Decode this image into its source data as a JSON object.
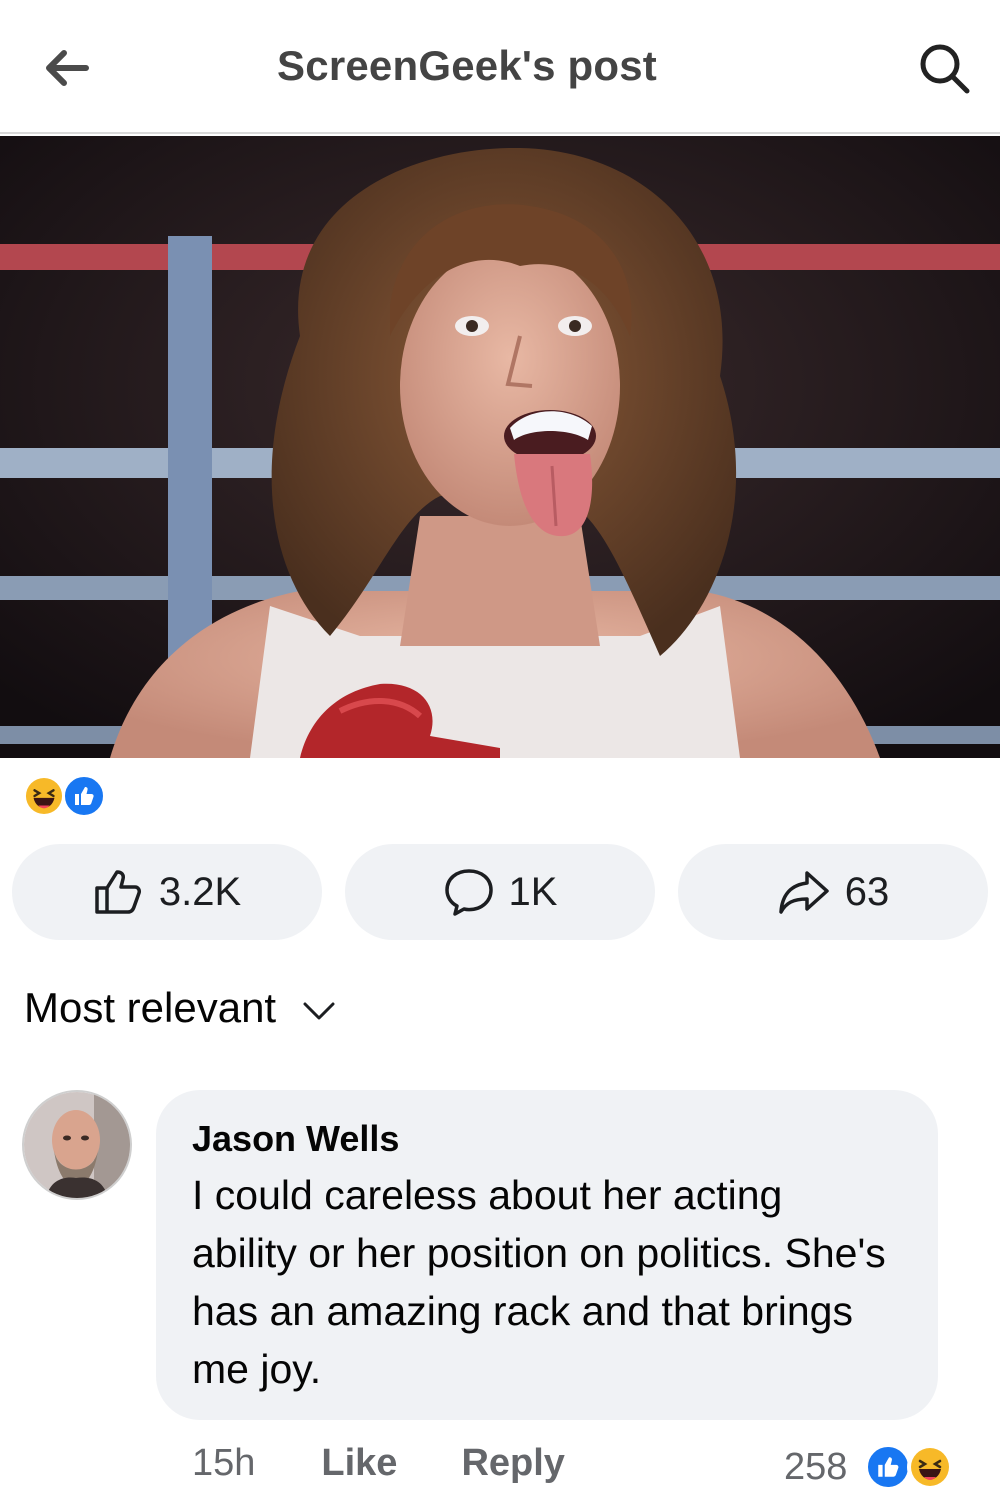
{
  "header": {
    "title": "ScreenGeek's post"
  },
  "post": {
    "reactions": {
      "icons": [
        "haha-icon",
        "like-icon"
      ]
    },
    "actions": {
      "like_count": "3.2K",
      "comment_count": "1K",
      "share_count": "63"
    }
  },
  "comments": {
    "sort_label": "Most relevant",
    "items": [
      {
        "author": "Jason Wells",
        "text": "I could careless about her acting ability or her position on politics. She's has an amazing rack and that brings me joy.",
        "time": "15h",
        "like_label": "Like",
        "reply_label": "Reply",
        "reaction_count": "258",
        "reaction_icons": [
          "like-icon",
          "haha-icon"
        ]
      }
    ]
  },
  "colors": {
    "facebook_blue": "#1877f2",
    "pill_background": "#f0f2f5",
    "meta_gray": "#65676b",
    "haha_yellow": "#f7b928"
  }
}
